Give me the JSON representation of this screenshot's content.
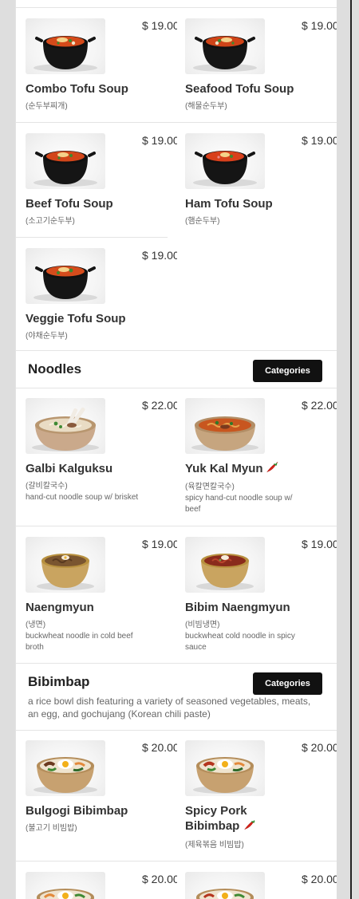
{
  "tofu_rows": [
    {
      "left": {
        "name": "Combo Tofu Soup",
        "price": "$ 19.00",
        "sub": "(순두부찌개)"
      },
      "right": {
        "name": "Seafood Tofu Soup",
        "price": "$ 19.00",
        "sub": "(해물순두부)"
      }
    },
    {
      "left": {
        "name": "Beef Tofu Soup",
        "price": "$ 19.00",
        "sub": "(소고기순두부)"
      },
      "right": {
        "name": "Ham Tofu Soup",
        "price": "$ 19.00",
        "sub": "(햄순두부)"
      }
    },
    {
      "left": {
        "name": "Veggie Tofu Soup",
        "price": "$ 19.00",
        "sub": "(야채순두부)"
      }
    }
  ],
  "noodles": {
    "title": "Noodles",
    "categories_label": "Categories",
    "rows": [
      {
        "left": {
          "name": "Galbi Kalguksu",
          "price": "$ 22.00",
          "sub": "(갈비칼국수)",
          "desc": "hand-cut noodle soup w/ brisket"
        },
        "right": {
          "name": "Yuk Kal Myun",
          "price": "$ 22.00",
          "sub": "(육칼면칼국수)",
          "desc": "spicy hand-cut noodle soup w/ beef",
          "spicy": true
        }
      },
      {
        "left": {
          "name": "Naengmyun",
          "price": "$ 19.00",
          "sub": "(냉면)",
          "desc": "buckwheat noodle in cold beef broth"
        },
        "right": {
          "name": "Bibim Naengmyun",
          "price": "$ 19.00",
          "sub": "(비빔냉면)",
          "desc": "buckwheat cold noodle in spicy sauce"
        }
      }
    ]
  },
  "bibimbap": {
    "title": "Bibimbap",
    "categories_label": "Categories",
    "description": "a rice bowl dish featuring a variety of seasoned vegetables, meats, an egg, and gochujang (Korean chili paste)",
    "rows": [
      {
        "left": {
          "name": "Bulgogi Bibimbap",
          "price": "$ 20.00",
          "sub": "(불고기 비빔밥)"
        },
        "right": {
          "name": "Spicy Pork Bibimbap",
          "price": "$ 20.00",
          "sub": "(제육볶음 비빔밥)",
          "spicy": true
        }
      },
      {
        "left": {
          "price": "$ 20.00"
        },
        "right": {
          "price": "$ 20.00"
        }
      }
    ]
  },
  "icons": {
    "food_image": "food-photo-icon",
    "spicy": "chili-pepper-icon"
  },
  "colors": {
    "background": "#dedede",
    "panel": "#ffffff",
    "button": "#111111",
    "button_text": "#ffffff",
    "chili": "#d8241b"
  }
}
